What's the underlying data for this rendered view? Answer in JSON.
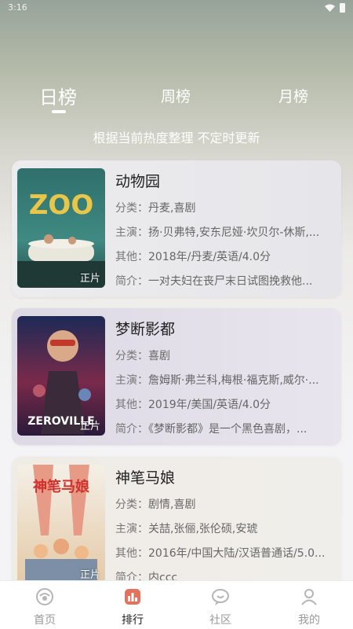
{
  "status_bar": {
    "time": "3:16"
  },
  "tabs": [
    {
      "label": "日榜",
      "active": true
    },
    {
      "label": "周榜",
      "active": false
    },
    {
      "label": "月榜",
      "active": false
    }
  ],
  "subtitle": "根据当前热度整理 不定时更新",
  "labels": {
    "category": "分类：",
    "cast": "主演：",
    "other": "其他：",
    "synopsis": "简介："
  },
  "movies": [
    {
      "title": "动物园",
      "poster_text": "ZOO",
      "badge": "正片",
      "category": "丹麦,喜剧",
      "cast": "扬·贝弗特,安东尼娅·坎贝尔-休斯,...",
      "other": "2018年/丹麦/英语/4.0分",
      "synopsis": "一对夫妇在丧尸末日试图挽救他..."
    },
    {
      "title": "梦断影都",
      "poster_text": "ZEROVILLE",
      "badge": "正片",
      "category": "喜剧",
      "cast": "詹姆斯·弗兰科,梅根·福克斯,威尔·...",
      "other": "2019年/美国/英语/4.0分",
      "synopsis": "《梦断影都》是一个黑色喜剧，..."
    },
    {
      "title": "神笔马娘",
      "poster_text": "神笔马娘",
      "badge": "正片",
      "category": "剧情,喜剧",
      "cast": "关喆,张俪,张伦硕,安琥",
      "other": "2016年/中国大陆/汉语普通话/5.0...",
      "synopsis": "内ccc"
    }
  ],
  "bottom_nav": [
    {
      "label": "首页",
      "icon": "home-icon",
      "active": false
    },
    {
      "label": "排行",
      "icon": "ranking-icon",
      "active": true
    },
    {
      "label": "社区",
      "icon": "community-icon",
      "active": false
    },
    {
      "label": "我的",
      "icon": "profile-icon",
      "active": false
    }
  ],
  "colors": {
    "accent_text": "#222222",
    "inactive_nav": "#9a9a9a",
    "header_top": "#97a39a"
  }
}
